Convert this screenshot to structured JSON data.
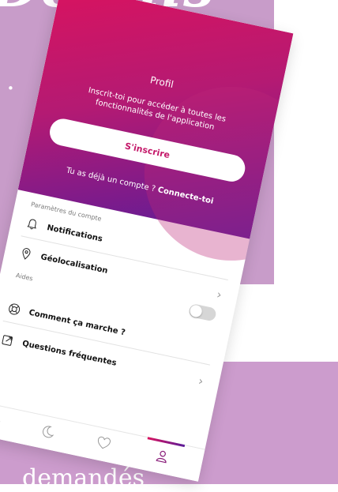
{
  "background": {
    "headline": "Détails",
    "dot": ".",
    "footer": "demandés"
  },
  "profile": {
    "title": "Profil",
    "intro": "Inscrit-toi pour accéder à toutes les fonctionnalités de l'application",
    "signup_label": "S'inscrire",
    "login_prompt": "Tu as déjà un compte ?",
    "login_link": "Connecte-toi"
  },
  "settings": {
    "section_label": "Paramètres du compte",
    "items": [
      {
        "label": "Notifications",
        "icon": "bell-icon"
      },
      {
        "label": "Géolocalisation",
        "icon": "location-pin-icon"
      }
    ]
  },
  "help": {
    "section_label": "Aides",
    "items": [
      {
        "label": "Comment ça marche ?",
        "icon": "lifebuoy-icon"
      },
      {
        "label": "Questions fréquentes",
        "icon": "external-link-icon"
      }
    ]
  },
  "tabbar": {
    "tabs": [
      "sun-icon",
      "moon-icon",
      "heart-icon",
      "profile-icon"
    ],
    "active": "profile-icon"
  },
  "colors": {
    "gradient_start": "#d9135f",
    "gradient_end": "#5b1c99",
    "accent": "#c41869",
    "background_purple": "#c89cc9"
  }
}
